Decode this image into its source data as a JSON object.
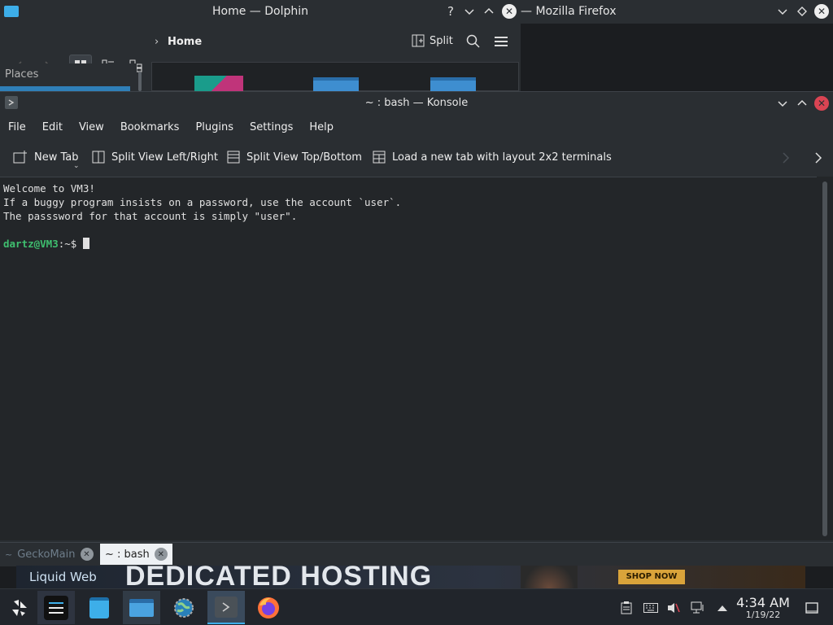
{
  "dolphin": {
    "title": "Home — Dolphin",
    "breadcrumb": "Home",
    "split_label": "Split",
    "places_label": "Places"
  },
  "firefox": {
    "title": "— Mozilla Firefox"
  },
  "konsole": {
    "title": "~ : bash — Konsole",
    "menu": [
      "File",
      "Edit",
      "View",
      "Bookmarks",
      "Plugins",
      "Settings",
      "Help"
    ],
    "toolbar": {
      "new_tab": "New Tab",
      "split_lr": "Split View Left/Right",
      "split_tb": "Split View Top/Bottom",
      "load_layout": "Load a new tab with layout 2x2 terminals"
    },
    "terminal": {
      "lines": [
        "Welcome to VM3!",
        "If a buggy program insists on a password, use the account `user`.",
        "The passsword for that account is simply \"user\"."
      ],
      "prompt_user": "dartz@VM3",
      "prompt_rest": ":~$ "
    },
    "tabs": [
      {
        "label": "GeckoMain",
        "active": false
      },
      {
        "label": "~ : bash",
        "active": true
      }
    ]
  },
  "ad": {
    "brand": "Liquid Web",
    "headline": "DEDICATED HOSTING",
    "cta": "SHOP NOW"
  },
  "taskbar": {
    "time": "4:34 AM",
    "date": "1/19/22"
  },
  "colors": {
    "accent": "#3daee9",
    "prompt": "#3fbf6f",
    "close_red": "#da4453"
  }
}
